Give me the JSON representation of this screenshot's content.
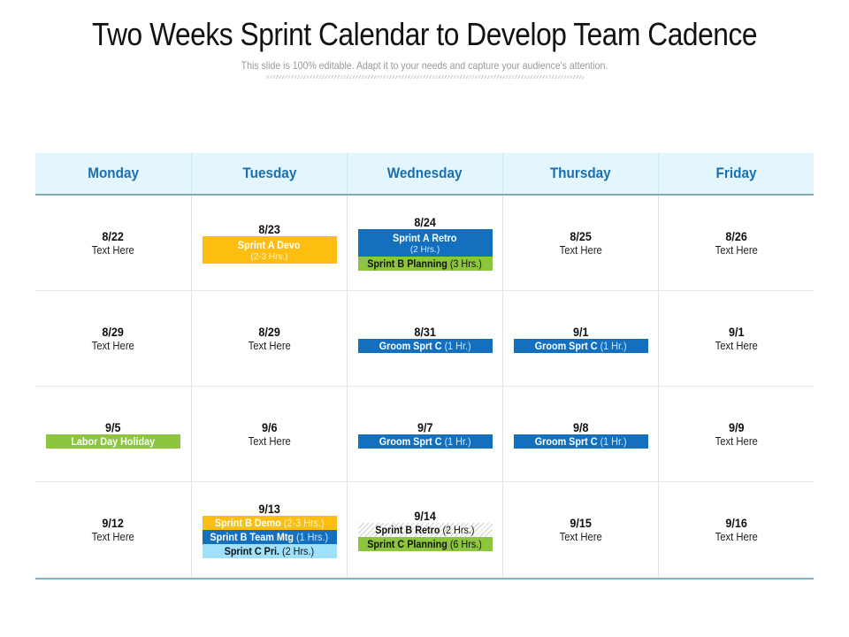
{
  "header": {
    "title": "Two Weeks Sprint Calendar to Develop Team Cadence",
    "subtitle": "This slide is 100% editable. Adapt it to your needs and capture your audience's attention."
  },
  "colors": {
    "header_bg": "#e3f6fd",
    "header_text": "#1b6fb1",
    "yellow": "#fdbe10",
    "blue": "#1470be",
    "green": "#8dc53f",
    "cyan": "#9fe0fa"
  },
  "calendar": {
    "days": [
      "Monday",
      "Tuesday",
      "Wednesday",
      "Thursday",
      "Friday"
    ],
    "weeks": [
      {
        "cells": [
          {
            "date": "8/22",
            "note": "Text Here"
          },
          {
            "date": "8/23",
            "events": [
              {
                "title": "Sprint A Devo",
                "detail": "(2-3 Hrs.)",
                "color": "yellow"
              }
            ]
          },
          {
            "date": "8/24",
            "events": [
              {
                "title": "Sprint A Retro",
                "detail": "(2 Hrs.)",
                "color": "blue"
              },
              {
                "title": "Sprint B Planning",
                "detail": "(3 Hrs.)",
                "color": "green"
              }
            ]
          },
          {
            "date": "8/25",
            "note": "Text Here"
          },
          {
            "date": "8/26",
            "note": "Text Here"
          }
        ]
      },
      {
        "cells": [
          {
            "date": "8/29",
            "note": "Text Here"
          },
          {
            "date": "8/29",
            "note": "Text Here"
          },
          {
            "date": "8/31",
            "events": [
              {
                "title": "Groom Sprt C",
                "detail": "(1 Hr.)",
                "color": "blue"
              }
            ]
          },
          {
            "date": "9/1",
            "events": [
              {
                "title": "Groom Sprt C",
                "detail": "(1 Hr.)",
                "color": "blue"
              }
            ]
          },
          {
            "date": "9/1",
            "note": "Text Here"
          }
        ]
      },
      {
        "cells": [
          {
            "date": "9/5",
            "events": [
              {
                "title": "Labor Day Holiday",
                "color": "green"
              }
            ]
          },
          {
            "date": "9/6",
            "note": "Text Here"
          },
          {
            "date": "9/7",
            "events": [
              {
                "title": "Groom Sprt C",
                "detail": "(1 Hr.)",
                "color": "blue"
              }
            ]
          },
          {
            "date": "9/8",
            "events": [
              {
                "title": "Groom Sprt C",
                "detail": "(1 Hr.)",
                "color": "blue"
              }
            ]
          },
          {
            "date": "9/9",
            "note": "Text Here"
          }
        ]
      },
      {
        "cells": [
          {
            "date": "9/12",
            "note": "Text Here"
          },
          {
            "date": "9/13",
            "events": [
              {
                "title": "Sprint B Demo",
                "detail": "(2-3 Hrs.)",
                "color": "yellow"
              },
              {
                "title": "Sprint B Team Mtg",
                "detail": "(1 Hrs.)",
                "color": "blue"
              },
              {
                "title": "Sprint C Pri.",
                "detail": "(2 Hrs.)",
                "color": "cyan"
              }
            ]
          },
          {
            "date": "9/14",
            "events": [
              {
                "title": "Sprint B Retro",
                "detail": "(2 Hrs.)",
                "color": "hatched"
              },
              {
                "title": "Sprint C Planning",
                "detail": "(6 Hrs.)",
                "color": "green"
              }
            ]
          },
          {
            "date": "9/15",
            "note": "Text Here"
          },
          {
            "date": "9/16",
            "note": "Text Here"
          }
        ]
      }
    ]
  }
}
